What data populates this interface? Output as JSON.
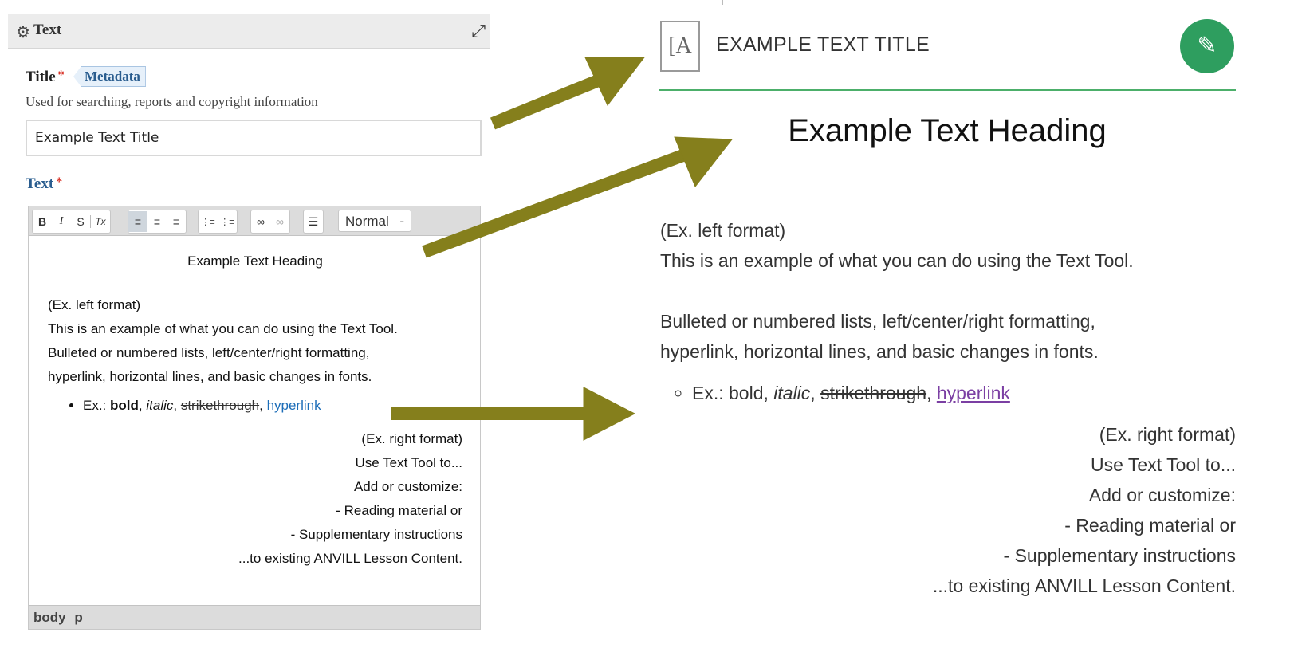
{
  "editor_panel": {
    "header_title": "Text",
    "title_label": "Title",
    "title_required": "*",
    "metadata_tag": "Metadata",
    "title_help": "Used for searching, reports and copyright information",
    "title_value": "Example Text Title",
    "text_label": "Text",
    "text_required": "*",
    "toolbar": {
      "bold": "B",
      "italic": "I",
      "strike": "S",
      "clear_format": "Tx",
      "align_left": "≡",
      "align_center": "≡",
      "align_right": "≡",
      "bulleted_list": "⋮≡",
      "numbered_list": "⋮≡",
      "link": "∞",
      "unlink": "∞",
      "horizontal_line": "☰",
      "format_select": "Normal",
      "format_caret": "-"
    },
    "content": {
      "heading": "Example Text Heading",
      "left_label": "(Ex. left format)",
      "line1": "This is an example of what you can do using the Text Tool.",
      "line2": "Bulleted or numbered lists, left/center/right formatting,",
      "line3": "hyperlink, horizontal lines, and basic changes in fonts.",
      "list_prefix": "Ex.: ",
      "list_bold": "bold",
      "list_sep1": ", ",
      "list_italic": "italic",
      "list_sep2": ", ",
      "list_strike": "strikethrough",
      "list_sep3": ", ",
      "list_link": "hyperlink",
      "right_lines": [
        "(Ex. right format)",
        "Use Text Tool to...",
        "Add or customize:",
        "- Reading material or",
        "- Supplementary instructions",
        "...to existing ANVILL Lesson Content."
      ]
    },
    "statusbar": "body  p"
  },
  "preview": {
    "icon_text": "[A",
    "title": "EXAMPLE TEXT TITLE",
    "edit_icon": "✎",
    "heading": "Example Text Heading",
    "left_label": "(Ex. left format)",
    "line1": "This is an example of what you can do using the Text Tool.",
    "line2": "Bulleted or numbered lists, left/center/right formatting,",
    "line3": "hyperlink, horizontal lines, and basic changes in fonts.",
    "list_prefix": "Ex.: bold, ",
    "list_italic": "italic",
    "list_sep": ", ",
    "list_strike": "strikethrough",
    "list_sep2": ", ",
    "list_link": "hyperlink",
    "right_lines": [
      "(Ex. right format)",
      "Use Text Tool to...",
      "Add or customize:",
      "- Reading material or",
      "- Supplementary instructions",
      "...to existing ANVILL Lesson Content."
    ]
  },
  "colors": {
    "arrow": "#857f1c",
    "edit_button": "#2e9e5f",
    "accent_line": "#4caf6a",
    "link": "#1c6db8",
    "visited_link": "#7b3fa3",
    "required": "#d9362b"
  }
}
